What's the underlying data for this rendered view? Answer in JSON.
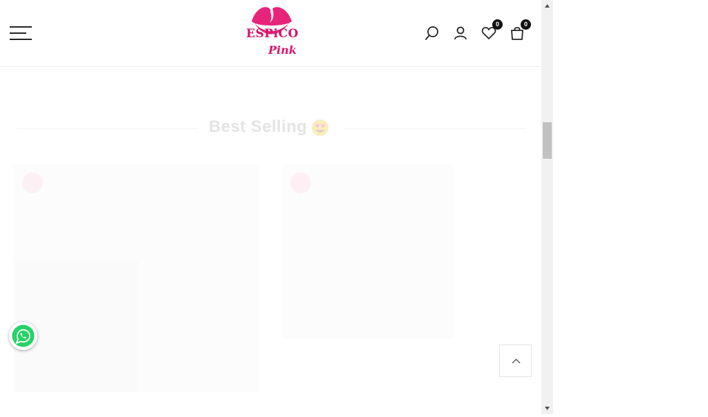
{
  "header": {
    "brand_name": "ESPiCO",
    "brand_sub": "Pink",
    "wishlist_count": "0",
    "cart_count": "0",
    "icons": [
      "menu-icon",
      "search-icon",
      "account-icon",
      "heart-icon",
      "bag-icon"
    ]
  },
  "section": {
    "title": "Best Selling",
    "title_emoji": "heart-eyes-emoji"
  },
  "colors": {
    "brand": "#d4146a",
    "title_faded": "#e4e4e4",
    "whatsapp_green": "#25d366"
  },
  "floating": {
    "whatsapp_icon": "whatsapp-icon",
    "back_to_top_icon": "chevron-up-icon"
  }
}
